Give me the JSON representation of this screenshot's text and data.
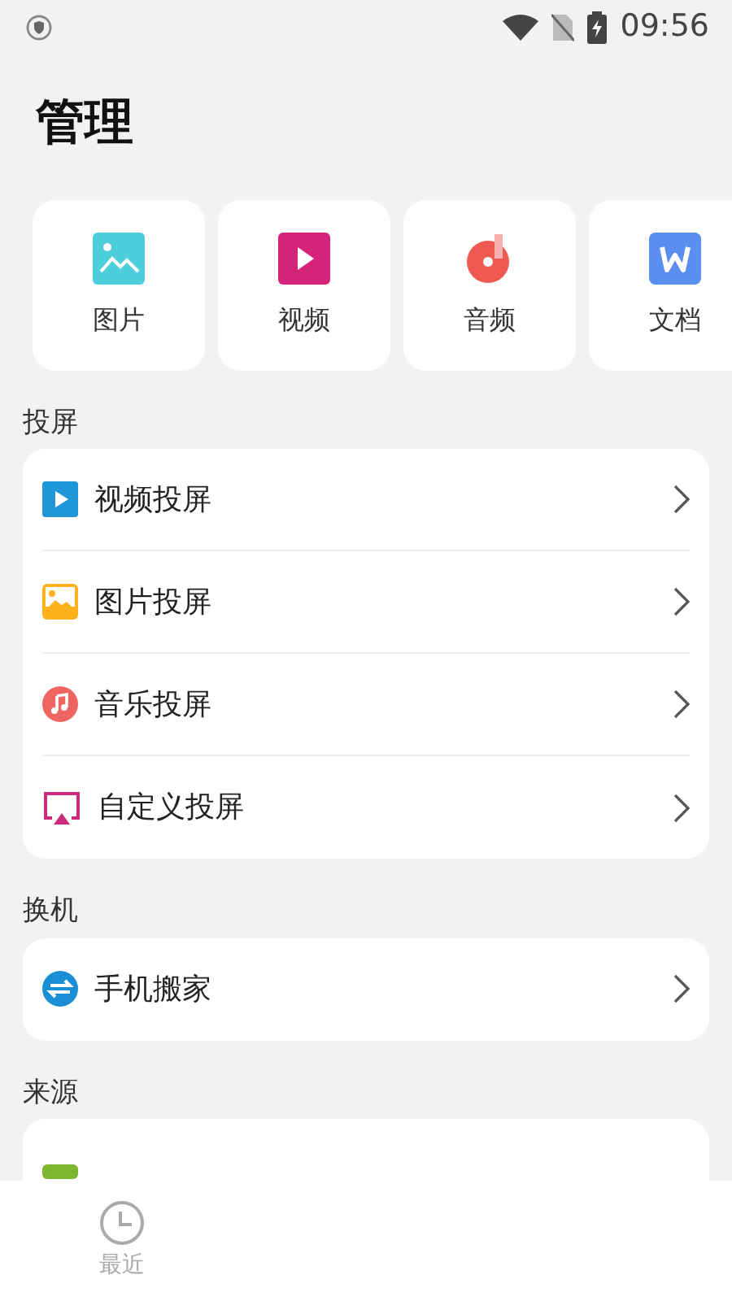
{
  "status_bar": {
    "time": "09:56"
  },
  "title": "管理",
  "categories": [
    {
      "label": "图片",
      "kind": "image"
    },
    {
      "label": "视频",
      "kind": "video"
    },
    {
      "label": "音频",
      "kind": "audio"
    },
    {
      "label": "文档",
      "kind": "doc"
    }
  ],
  "sections": [
    {
      "heading": "投屏",
      "items": [
        {
          "label": "视频投屏",
          "kind": "video"
        },
        {
          "label": "图片投屏",
          "kind": "image"
        },
        {
          "label": "音乐投屏",
          "kind": "music"
        },
        {
          "label": "自定义投屏",
          "kind": "cast"
        }
      ]
    },
    {
      "heading": "换机",
      "items": [
        {
          "label": "手机搬家",
          "kind": "transfer"
        }
      ]
    },
    {
      "heading": "来源",
      "items": [
        {
          "kind": "partial"
        }
      ]
    }
  ],
  "bottom_nav": [
    {
      "label": "最近",
      "selected": false
    }
  ]
}
